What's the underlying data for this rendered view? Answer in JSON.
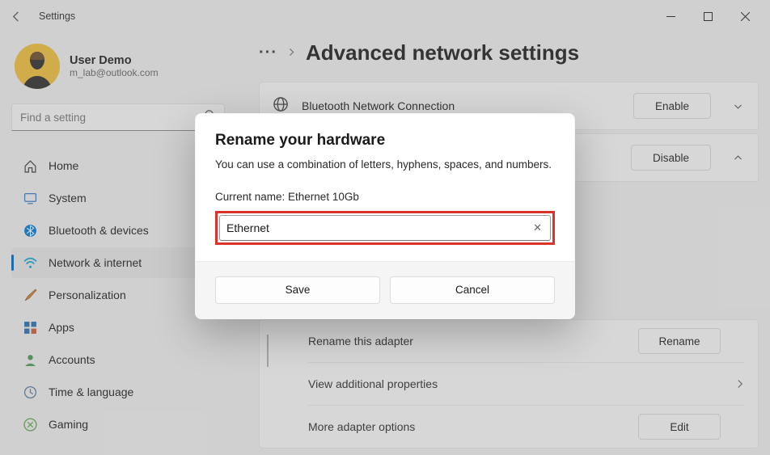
{
  "window": {
    "title": "Settings"
  },
  "user": {
    "name": "User Demo",
    "email": "m_lab@outlook.com"
  },
  "search": {
    "placeholder": "Find a setting"
  },
  "nav": {
    "items": [
      {
        "label": "Home"
      },
      {
        "label": "System"
      },
      {
        "label": "Bluetooth & devices"
      },
      {
        "label": "Network & internet"
      },
      {
        "label": "Personalization"
      },
      {
        "label": "Apps"
      },
      {
        "label": "Accounts"
      },
      {
        "label": "Time & language"
      },
      {
        "label": "Gaming"
      }
    ]
  },
  "page": {
    "ellipsis": "···",
    "title": "Advanced network settings"
  },
  "adapters": {
    "bluetooth": {
      "name": "Bluetooth Network Connection",
      "button": "Enable"
    },
    "ethernet": {
      "button": "Disable"
    }
  },
  "details": {
    "rename": {
      "label": "Rename this adapter",
      "button": "Rename"
    },
    "view_props": {
      "label": "View additional properties"
    },
    "more_options": {
      "label": "More adapter options",
      "button": "Edit"
    }
  },
  "dialog": {
    "title": "Rename your hardware",
    "desc": "You can use a combination of letters, hyphens, spaces, and numbers.",
    "current_label": "Current name: Ethernet 10Gb",
    "input_value": "Ethernet",
    "save": "Save",
    "cancel": "Cancel"
  }
}
